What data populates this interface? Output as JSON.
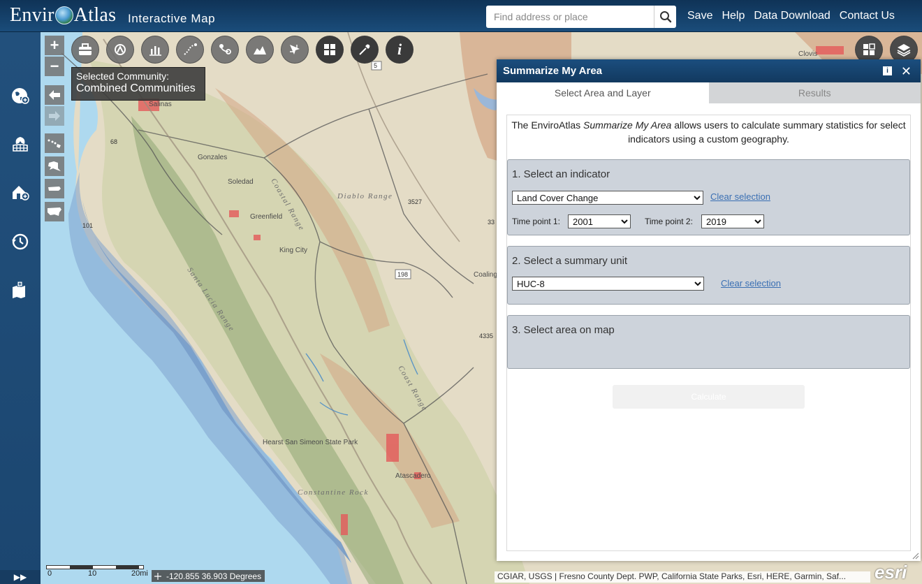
{
  "header": {
    "logo_left": "Envir",
    "logo_right": "Atlas",
    "subtitle": "Interactive Map",
    "search_placeholder": "Find address or place",
    "nav": [
      "Save",
      "Help",
      "Data Download",
      "Contact Us"
    ]
  },
  "map": {
    "community_label": "Selected Community:",
    "community_value": "Combined Communities",
    "scale_labels": [
      "0",
      "10",
      "20mi"
    ],
    "coordinates": "-120.855 36.903 Degrees",
    "attribution": "CGIAR, USGS | Fresno County Dept. PWP, California State Parks, Esri, HERE, Garmin, Saf...",
    "esri": "esri",
    "place_labels": [
      "Salinas",
      "Gonzales",
      "Soledad",
      "Greenfield",
      "King City",
      "Coastal Range",
      "Diablo Range",
      "Coalinga",
      "Hearst San Simeon State Park",
      "Atascadero",
      "Constantine Rock",
      "Clovis",
      "Coast Range",
      "Santa Lucia Range"
    ],
    "road_shields": [
      "5",
      "198",
      "101",
      "68",
      "4335",
      "3527",
      "33"
    ]
  },
  "panel": {
    "title": "Summarize My Area",
    "tabs": [
      "Select Area and Layer",
      "Results"
    ],
    "intro_before": "The EnviroAtlas ",
    "intro_em": "Summarize My Area",
    "intro_after": " allows users to calculate summary statistics for select indicators using a custom geography.",
    "step1": {
      "title": "1. Select an indicator",
      "indicator": "Land Cover Change",
      "clear": "Clear selection",
      "tp1_label": "Time point 1:",
      "tp1": "2001",
      "tp2_label": "Time point 2:",
      "tp2": "2019"
    },
    "step2": {
      "title": "2. Select a summary unit",
      "unit": "HUC-8",
      "clear": "Clear selection"
    },
    "step3": {
      "title": "3. Select area on map"
    },
    "calculate": "Calculate"
  }
}
